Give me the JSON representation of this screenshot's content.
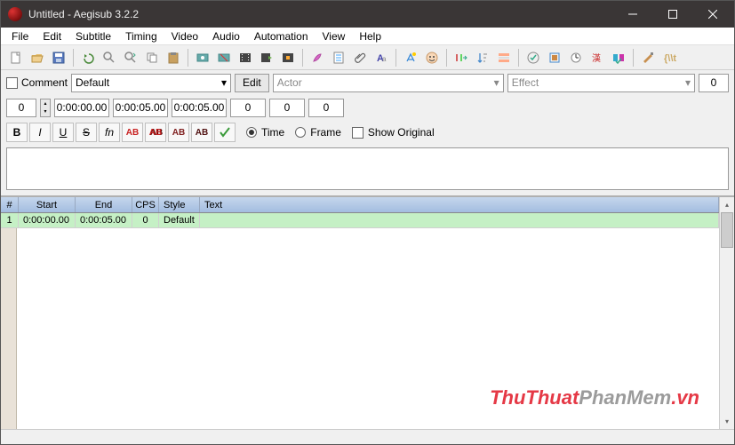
{
  "titlebar": {
    "title": "Untitled - Aegisub 3.2.2"
  },
  "menu": {
    "items": [
      "File",
      "Edit",
      "Subtitle",
      "Timing",
      "Video",
      "Audio",
      "Automation",
      "View",
      "Help"
    ]
  },
  "edit": {
    "comment_label": "Comment",
    "style_value": "Default",
    "edit_btn": "Edit",
    "actor_placeholder": "Actor",
    "effect_placeholder": "Effect",
    "layer": "0",
    "margin_r": "0",
    "start": "0:00:00.00",
    "end": "0:00:05.00",
    "duration": "0:00:05.00",
    "ml": "0",
    "mr": "0",
    "mv": "0",
    "time_label": "Time",
    "frame_label": "Frame",
    "show_original_label": "Show Original",
    "fn_label": "fn",
    "ab_label": "AB"
  },
  "grid": {
    "headers": {
      "n": "#",
      "start": "Start",
      "end": "End",
      "cps": "CPS",
      "style": "Style",
      "text": "Text"
    },
    "rows": [
      {
        "n": "1",
        "start": "0:00:00.00",
        "end": "0:00:05.00",
        "cps": "0",
        "style": "Default",
        "text": ""
      }
    ]
  },
  "watermark": {
    "a": "ThuThuat",
    "b": "PhanMem",
    "c": ".vn"
  }
}
